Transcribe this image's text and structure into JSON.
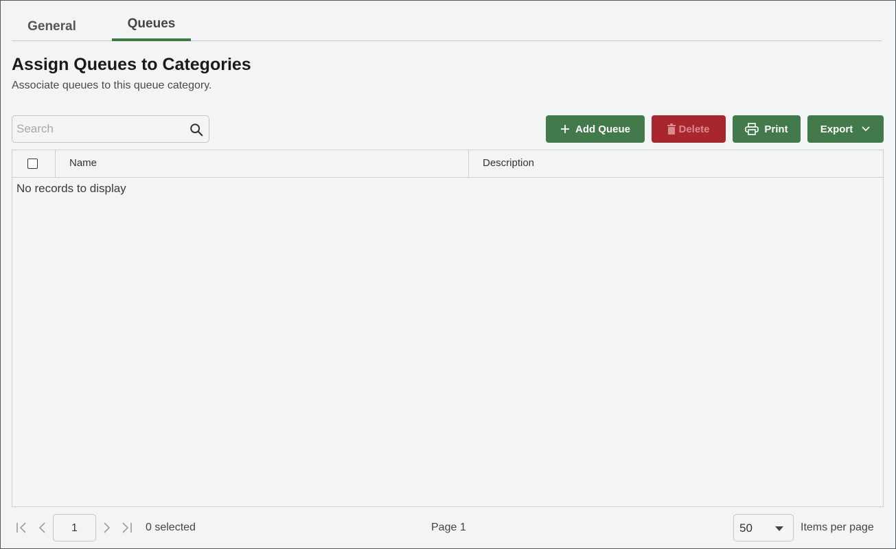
{
  "tabs": [
    {
      "label": "General",
      "active": false
    },
    {
      "label": "Queues",
      "active": true
    }
  ],
  "header": {
    "title": "Assign Queues to Categories",
    "subtitle": "Associate queues to this queue category."
  },
  "search": {
    "placeholder": "Search",
    "value": ""
  },
  "toolbar": {
    "add_label": "Add Queue",
    "delete_label": "Delete",
    "print_label": "Print",
    "export_label": "Export"
  },
  "grid": {
    "columns": [
      "Name",
      "Description"
    ],
    "rows": [],
    "empty_text": "No records to display"
  },
  "pager": {
    "page_number": "1",
    "selected_text": "0 selected",
    "page_info": "Page 1",
    "items_per_page": "50",
    "items_per_page_label": "Items per page"
  },
  "colors": {
    "accent": "#437a4b",
    "danger": "#a8262d",
    "background": "#f3f4f6"
  },
  "icons": {
    "search": "search-icon",
    "add": "plus-icon",
    "delete": "trash-icon",
    "print": "printer-icon",
    "export": "chevron-down-icon",
    "first": "first-page-icon",
    "prev": "prev-page-icon",
    "next": "next-page-icon",
    "last": "last-page-icon",
    "dropdown": "caret-down-icon"
  }
}
